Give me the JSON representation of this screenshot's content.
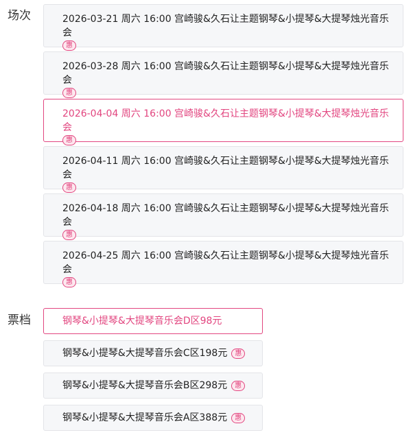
{
  "labels": {
    "sessions": "场次",
    "tiers": "票档"
  },
  "badge_text": "惠",
  "sessions": [
    {
      "text": "2026-03-21 周六 16:00 宫崎骏&久石让主题钢琴&小提琴&大提琴烛光音乐会",
      "selected": false,
      "badge": true
    },
    {
      "text": "2026-03-28 周六 16:00 宫崎骏&久石让主题钢琴&小提琴&大提琴烛光音乐会",
      "selected": false,
      "badge": true
    },
    {
      "text": "2026-04-04 周六 16:00 宫崎骏&久石让主题钢琴&小提琴&大提琴烛光音乐会",
      "selected": true,
      "badge": true
    },
    {
      "text": "2026-04-11 周六 16:00 宫崎骏&久石让主题钢琴&小提琴&大提琴烛光音乐会",
      "selected": false,
      "badge": true
    },
    {
      "text": "2026-04-18 周六 16:00 宫崎骏&久石让主题钢琴&小提琴&大提琴烛光音乐会",
      "selected": false,
      "badge": true
    },
    {
      "text": "2026-04-25 周六 16:00 宫崎骏&久石让主题钢琴&小提琴&大提琴烛光音乐会",
      "selected": false,
      "badge": true
    }
  ],
  "tiers": [
    {
      "text": "钢琴&小提琴&大提琴音乐会D区98元",
      "selected": true,
      "badge": false
    },
    {
      "text": "钢琴&小提琴&大提琴音乐会C区198元",
      "selected": false,
      "badge": true
    },
    {
      "text": "钢琴&小提琴&大提琴音乐会B区298元",
      "selected": false,
      "badge": true
    },
    {
      "text": "钢琴&小提琴&大提琴音乐会A区388元",
      "selected": false,
      "badge": true
    }
  ],
  "colors": {
    "accent": "#e2457f",
    "option_bg": "#f6f7f9",
    "option_border": "#e3e4e8"
  }
}
